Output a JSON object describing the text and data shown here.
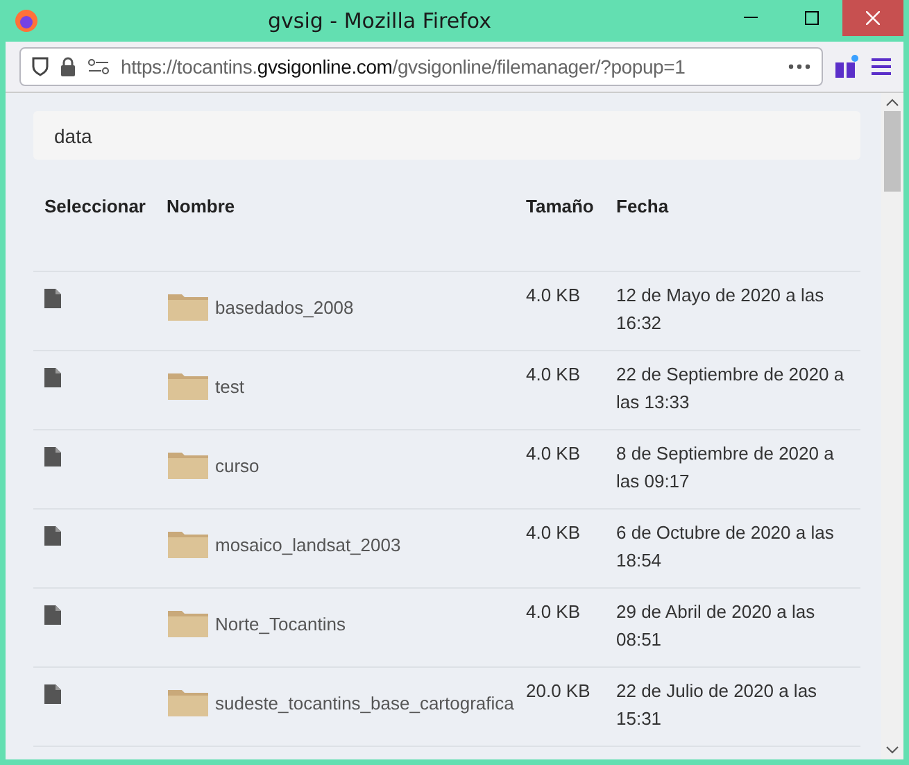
{
  "window": {
    "title": "gvsig - Mozilla Firefox"
  },
  "address_bar": {
    "url_prefix": "https://tocantins.",
    "url_domain": "gvsigonline.com",
    "url_path": "/gvsigonline/filemanager/?popup=1"
  },
  "breadcrumb": "data",
  "table": {
    "columns": [
      "Seleccionar",
      "Nombre",
      "Tamaño",
      "Fecha"
    ],
    "rows": [
      {
        "name": "basedados_2008",
        "size": "4.0 KB",
        "date": "12 de Mayo de 2020 a las 16:32"
      },
      {
        "name": "test",
        "size": "4.0 KB",
        "date": "22 de Septiembre de 2020 a las 13:33"
      },
      {
        "name": "curso",
        "size": "4.0 KB",
        "date": "8 de Septiembre de 2020 a las 09:17"
      },
      {
        "name": "mosaico_landsat_2003",
        "size": "4.0 KB",
        "date": "6 de Octubre de 2020 a las 18:54"
      },
      {
        "name": "Norte_Tocantins",
        "size": "4.0 KB",
        "date": "29 de Abril de 2020 a las 08:51"
      },
      {
        "name": "sudeste_tocantins_base_cartografica",
        "size": "20.0 KB",
        "date": "22 de Julio de 2020 a las 15:31"
      }
    ]
  }
}
